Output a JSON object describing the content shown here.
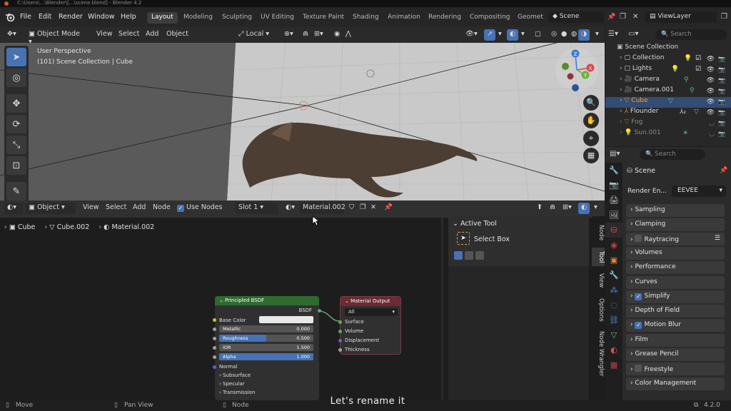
{
  "title_bar": {
    "text": "C:\\Users\\...\\Blender\\[...\\scene.blend] - Blender 4.2"
  },
  "menu": [
    "File",
    "Edit",
    "Render",
    "Window",
    "Help"
  ],
  "workspaces": [
    "Layout",
    "Modeling",
    "Sculpting",
    "UV Editing",
    "Texture Paint",
    "Shading",
    "Animation",
    "Rendering",
    "Compositing",
    "Geomet"
  ],
  "active_workspace": "Layout",
  "scene_name": "Scene",
  "view_layer": "ViewLayer",
  "viewport": {
    "mode": "Object Mode",
    "menus": [
      "View",
      "Select",
      "Add",
      "Object"
    ],
    "transform_orientation": "Local",
    "overlay_line1": "User Perspective",
    "overlay_line2": "(101) Scene Collection | Cube",
    "gizmo": {
      "z": "Z",
      "x": "X",
      "y": "Y"
    }
  },
  "outliner": {
    "search_placeholder": "Search",
    "root": "Scene Collection",
    "items": [
      {
        "label": "Collection",
        "selected": false,
        "dim": false
      },
      {
        "label": "Lights",
        "selected": false,
        "dim": false
      },
      {
        "label": "Camera",
        "selected": false,
        "dim": false
      },
      {
        "label": "Camera.001",
        "selected": false,
        "dim": false
      },
      {
        "label": "Cube",
        "selected": true,
        "dim": false
      },
      {
        "label": "Flounder",
        "selected": false,
        "dim": false
      },
      {
        "label": "Fog",
        "selected": false,
        "dim": true
      },
      {
        "label": "Sun.001",
        "selected": false,
        "dim": true
      }
    ]
  },
  "properties": {
    "search_placeholder": "Search",
    "context": "Scene",
    "render_engine_label": "Render En...",
    "render_engine_value": "EEVEE",
    "sections": [
      {
        "label": "Sampling",
        "checkbox": "none"
      },
      {
        "label": "Clamping",
        "checkbox": "none"
      },
      {
        "label": "Raytracing",
        "checkbox": "off"
      },
      {
        "label": "Volumes",
        "checkbox": "none"
      },
      {
        "label": "Performance",
        "checkbox": "none"
      },
      {
        "label": "Curves",
        "checkbox": "none"
      },
      {
        "label": "Simplify",
        "checkbox": "on"
      },
      {
        "label": "Depth of Field",
        "checkbox": "none"
      },
      {
        "label": "Motion Blur",
        "checkbox": "on"
      },
      {
        "label": "Film",
        "checkbox": "none"
      },
      {
        "label": "Grease Pencil",
        "checkbox": "none"
      },
      {
        "label": "Freestyle",
        "checkbox": "off"
      },
      {
        "label": "Color Management",
        "checkbox": "none"
      }
    ]
  },
  "node_editor": {
    "object_type": "Object",
    "menus": [
      "View",
      "Select",
      "Add",
      "Node"
    ],
    "use_nodes_label": "Use Nodes",
    "slot": "Slot 1",
    "material": "Material.002",
    "breadcrumb": [
      "Cube",
      "Cube.002",
      "Material.002"
    ],
    "bsdf": {
      "title": "Principled BSDF",
      "output": "BSDF",
      "base_color": "Base Color",
      "rows": [
        {
          "label": "Metallic",
          "value": "0.000",
          "fill": 0.0
        },
        {
          "label": "Roughness",
          "value": "0.500",
          "fill": 0.5
        },
        {
          "label": "IOR",
          "value": "1.500",
          "fill": 0.0
        },
        {
          "label": "Alpha",
          "value": "1.000",
          "fill": 1.0
        }
      ],
      "normal": "Normal",
      "subs": [
        "Subsurface",
        "Specular",
        "Transmission"
      ]
    },
    "output_node": {
      "title": "Material Output",
      "target": "All",
      "inputs": [
        "Surface",
        "Volume",
        "Displacement",
        "Thickness"
      ]
    },
    "n_panel": {
      "header": "Active Tool",
      "tool": "Select Box",
      "tabs": [
        "Node",
        "Tool",
        "View",
        "Options",
        "Node Wrangler"
      ]
    }
  },
  "status_bar": {
    "left": "Move",
    "mid": "Pan View",
    "right": "Node",
    "version": "4.2.0"
  },
  "caption": "Let's rename it"
}
